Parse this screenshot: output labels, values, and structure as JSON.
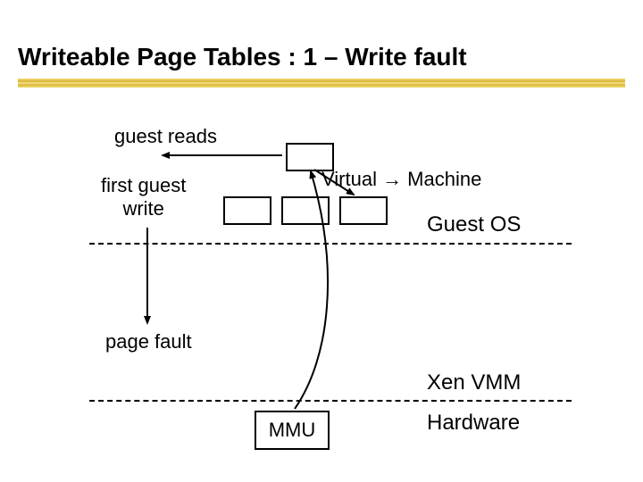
{
  "title": "Writeable Page Tables : 1 – Write fault",
  "labels": {
    "guest_reads": "guest reads",
    "first_guest_write": "first guest\nwrite",
    "virtual_machine": "Virtual → Machine",
    "guest_os": "Guest OS",
    "page_fault": "page fault",
    "xen_vmm": "Xen VMM",
    "hardware": "Hardware",
    "mmu": "MMU"
  }
}
